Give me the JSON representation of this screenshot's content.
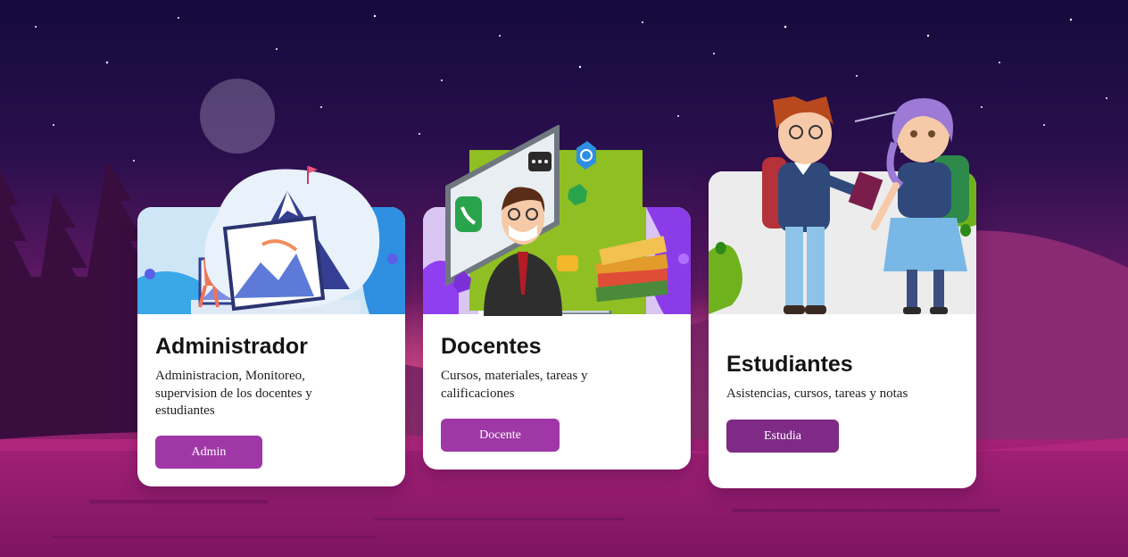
{
  "cards": [
    {
      "title": "Administrador",
      "description": "Administracion, Monitoreo, supervision de los docentes y estudiantes",
      "button_label": "Admin"
    },
    {
      "title": "Docentes",
      "description": "Cursos, materiales, tareas y calificaciones",
      "button_label": "Docente"
    },
    {
      "title": "Estudiantes",
      "description": "Asistencias, cursos, tareas y notas",
      "button_label": "Estudia"
    }
  ],
  "colors": {
    "button_primary": "#9f37a7",
    "button_dark": "#7e2a86",
    "sky_top": "#160a3e",
    "sky_mid": "#5a1660",
    "horizon": "#e2457e"
  }
}
